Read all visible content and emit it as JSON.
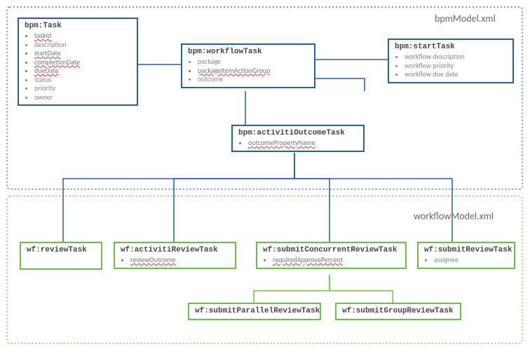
{
  "regions": {
    "top": {
      "label": "bpmModel.xml"
    },
    "bottom": {
      "label": "workflowModel.xml"
    }
  },
  "nodes": {
    "task": {
      "title": "bpm:Task",
      "items": [
        {
          "t": "taskId",
          "err": true
        },
        {
          "t": "description",
          "err": false
        },
        {
          "t": "startDate",
          "err": true
        },
        {
          "t": "completionDate",
          "err": true
        },
        {
          "t": "dueDate",
          "err": true
        },
        {
          "t": "status",
          "err": false
        },
        {
          "t": "priority",
          "err": false
        },
        {
          "t": "owner",
          "err": false
        }
      ]
    },
    "workflowTask": {
      "title": "bpm:workflowTask",
      "items": [
        {
          "t": "package",
          "err": false
        },
        {
          "t": "packageItemActionGroup",
          "err": true
        },
        {
          "t": "outcome",
          "err": false
        }
      ]
    },
    "startTask": {
      "title": "bpm:startTask",
      "items": [
        {
          "t": "workflow description",
          "err": false
        },
        {
          "t": "workflow priority",
          "err": false
        },
        {
          "t": "workflow due date",
          "err": false
        }
      ]
    },
    "activitiOutcomeTask": {
      "title": "bpm:activitiOutcomeTask",
      "items": [
        {
          "t": "outcomePropertyName",
          "err": true
        }
      ]
    },
    "reviewTask": {
      "title": "wf:reviewTask",
      "items": []
    },
    "activitiReviewTask": {
      "title": "wf:activitiReviewTask",
      "items": [
        {
          "t": "reviewOutcome",
          "err": true
        }
      ]
    },
    "submitConcurrentReviewTask": {
      "title": "wf:submitConcurrentReviewTask",
      "items": [
        {
          "t": "requiredApprovePercent",
          "err": true
        }
      ]
    },
    "submitReviewTask": {
      "title": "wf:submitReviewTask",
      "items": [
        {
          "t": "assignee",
          "err": false
        }
      ]
    },
    "submitParallelReviewTask": {
      "title": "wf:submitParallelReviewTask",
      "items": []
    },
    "submitGroupReviewTask": {
      "title": "wf:submitGroupReviewTask",
      "items": []
    }
  }
}
